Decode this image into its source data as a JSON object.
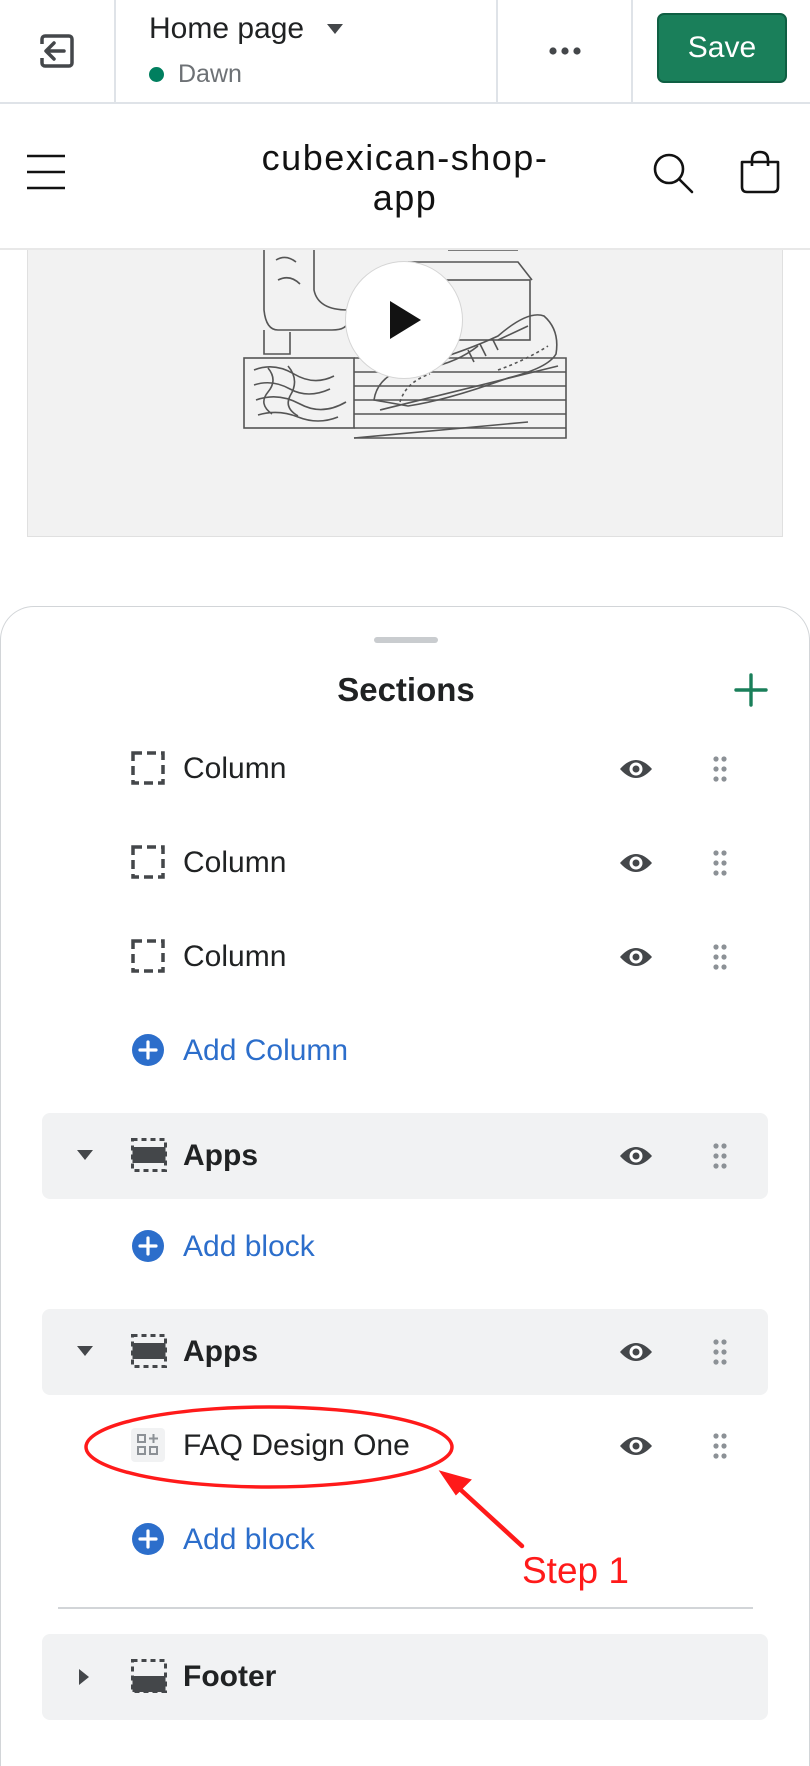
{
  "topbar": {
    "exit_icon": "exit-icon",
    "page_title": "Home page",
    "theme_name": "Dawn",
    "theme_status_color": "#007f5f",
    "more_icon": "more-horizontal-icon",
    "save_label": "Save",
    "save_color": "#1a7f5a"
  },
  "store": {
    "name": "cubexican-shop-app",
    "menu_icon": "hamburger-menu-icon",
    "search_icon": "search-icon",
    "cart_icon": "cart-icon"
  },
  "preview": {
    "play_icon": "play-icon"
  },
  "sections": {
    "title": "Sections",
    "add_icon": "plus-icon",
    "items": [
      {
        "label": "Column",
        "type": "block"
      },
      {
        "label": "Column",
        "type": "block"
      },
      {
        "label": "Column",
        "type": "block"
      },
      {
        "label": "Add Column",
        "type": "add"
      },
      {
        "label": "Apps",
        "type": "section",
        "expanded": true
      },
      {
        "label": "Add block",
        "type": "add"
      },
      {
        "label": "Apps",
        "type": "section",
        "expanded": true
      },
      {
        "label": "FAQ Design One",
        "type": "app-block"
      },
      {
        "label": "Add block",
        "type": "add"
      },
      {
        "label": "Footer",
        "type": "section",
        "expanded": false
      }
    ]
  },
  "annotation": {
    "label": "Step 1",
    "color": "#ff1a1a"
  }
}
